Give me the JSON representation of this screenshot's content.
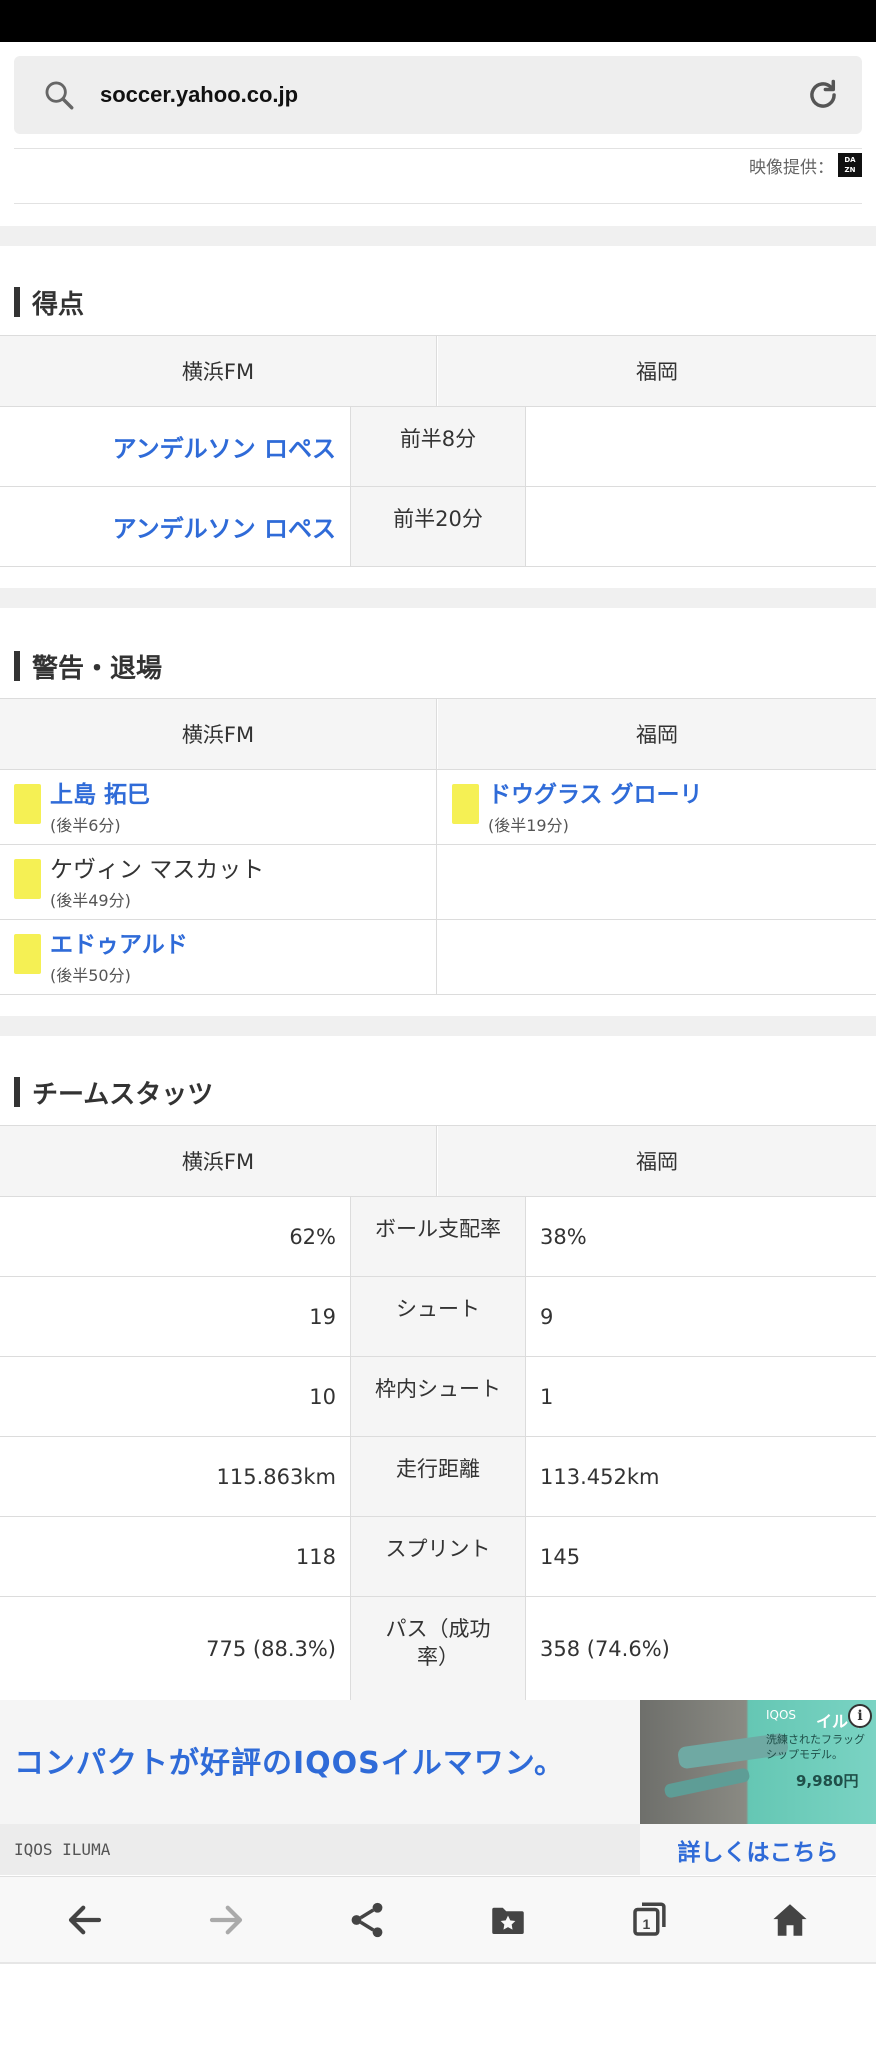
{
  "browser": {
    "url": "soccer.yahoo.co.jp"
  },
  "video_credit": {
    "label": "映像提供：",
    "logo_text": "DA ZN"
  },
  "teams": {
    "home": "横浜FM",
    "away": "福岡"
  },
  "goals": {
    "title": "得点",
    "rows": [
      {
        "home_player": "アンデルソン ロペス",
        "time": "前半8分",
        "away_player": ""
      },
      {
        "home_player": "アンデルソン ロペス",
        "time": "前半20分",
        "away_player": ""
      }
    ]
  },
  "cards": {
    "title": "警告・退場",
    "rows": [
      {
        "home": {
          "player": "上島 拓巳",
          "time": "(後半6分)"
        },
        "away": {
          "player": "ドウグラス グローリ",
          "time": "(後半19分)"
        }
      },
      {
        "home": {
          "player": "ケヴィン マスカット",
          "time": "(後半49分)"
        },
        "away": null
      },
      {
        "home": {
          "player": "エドゥアルド",
          "time": "(後半50分)"
        },
        "away": null
      }
    ]
  },
  "stats": {
    "title": "チームスタッツ",
    "rows": [
      {
        "label": "ボール支配率",
        "home": "62%",
        "away": "38%"
      },
      {
        "label": "シュート",
        "home": "19",
        "away": "9"
      },
      {
        "label": "枠内シュート",
        "home": "10",
        "away": "1"
      },
      {
        "label": "走行距離",
        "home": "115.863km",
        "away": "113.452km"
      },
      {
        "label": "スプリント",
        "home": "118",
        "away": "145"
      },
      {
        "label": "パス（成功率）",
        "home": "775 (88.3%)",
        "away": "358 (74.6%)"
      }
    ]
  },
  "ad": {
    "headline": "コンパクトが好評のIQOSイルマワン。",
    "sponsor": "IQOS ILUMA",
    "cta": "詳しくはこちら",
    "image": {
      "brand": "IQOS",
      "name": "イルマ",
      "slogan": "洗練されたフラッグシップモデル。",
      "price": "9,980円"
    }
  },
  "nav": {
    "icons": [
      "back-arrow-icon",
      "forward-arrow-icon",
      "share-icon",
      "bookmarks-icon",
      "tabs-icon",
      "home-icon"
    ],
    "tab_count": "1"
  },
  "colors": {
    "link_blue": "#2f6bd8",
    "yellow_card": "#f5f054",
    "header_bg": "#f5f5f5"
  }
}
